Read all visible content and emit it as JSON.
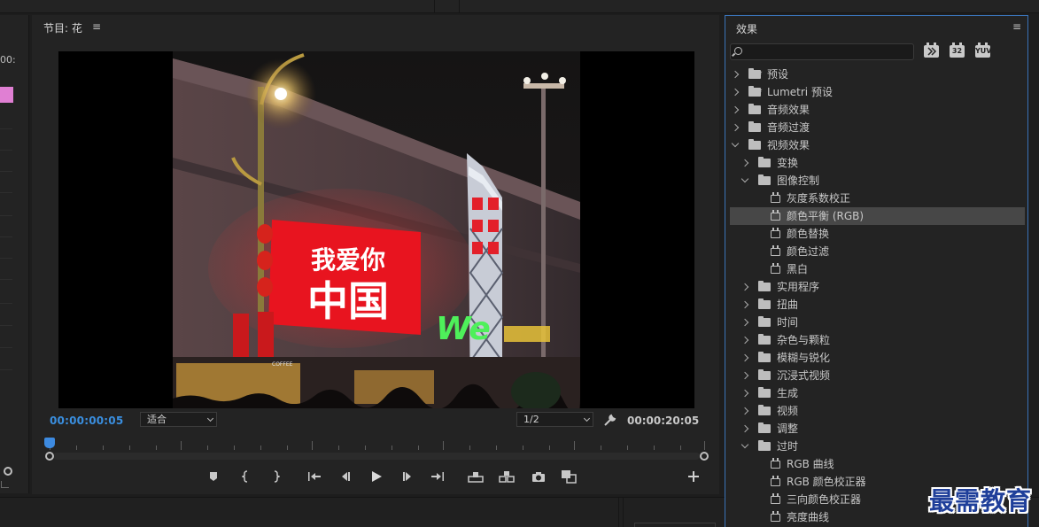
{
  "program_monitor": {
    "title": "节目: 花",
    "menu_glyph": "≡",
    "current_timecode": "00:00:00:05",
    "fit_select": "适合",
    "resolution_select": "1/2",
    "duration_timecode": "00:00:20:05"
  },
  "left_panel": {
    "timecode_fragment": "00:"
  },
  "video_frame": {
    "billboard_line1": "我爱你",
    "billboard_line2": "中国",
    "store_sign": "We",
    "coffee_sign": "COFFEE"
  },
  "transport_icons": [
    "marker-icon",
    "mark-in-icon",
    "mark-out-icon",
    "go-to-in-icon",
    "step-back-icon",
    "play-icon",
    "step-forward-icon",
    "go-to-out-icon",
    "lift-icon",
    "extract-icon",
    "export-frame-icon",
    "compare-icon",
    "add-button-icon"
  ],
  "effects_panel": {
    "title": "效果",
    "menu_glyph": "≡",
    "search_placeholder": "",
    "badges": [
      "32",
      "YUV"
    ],
    "tree": [
      {
        "label": "预设",
        "type": "folder-star",
        "level": 0,
        "expanded": false
      },
      {
        "label": "Lumetri 预设",
        "type": "folder-star",
        "level": 0,
        "expanded": false
      },
      {
        "label": "音频效果",
        "type": "folder",
        "level": 0,
        "expanded": false
      },
      {
        "label": "音频过渡",
        "type": "folder",
        "level": 0,
        "expanded": false
      },
      {
        "label": "视频效果",
        "type": "folder",
        "level": 0,
        "expanded": true
      },
      {
        "label": "变换",
        "type": "folder",
        "level": 1,
        "expanded": false
      },
      {
        "label": "图像控制",
        "type": "folder",
        "level": 1,
        "expanded": true
      },
      {
        "label": "灰度系数校正",
        "type": "effect",
        "level": 2
      },
      {
        "label": "颜色平衡 (RGB)",
        "type": "effect",
        "level": 2,
        "selected": true
      },
      {
        "label": "颜色替换",
        "type": "effect",
        "level": 2
      },
      {
        "label": "颜色过滤",
        "type": "effect",
        "level": 2
      },
      {
        "label": "黑白",
        "type": "effect",
        "level": 2
      },
      {
        "label": "实用程序",
        "type": "folder",
        "level": 1,
        "expanded": false
      },
      {
        "label": "扭曲",
        "type": "folder",
        "level": 1,
        "expanded": false
      },
      {
        "label": "时间",
        "type": "folder",
        "level": 1,
        "expanded": false
      },
      {
        "label": "杂色与颗粒",
        "type": "folder",
        "level": 1,
        "expanded": false
      },
      {
        "label": "模糊与锐化",
        "type": "folder",
        "level": 1,
        "expanded": false
      },
      {
        "label": "沉浸式视频",
        "type": "folder",
        "level": 1,
        "expanded": false
      },
      {
        "label": "生成",
        "type": "folder",
        "level": 1,
        "expanded": false
      },
      {
        "label": "视频",
        "type": "folder",
        "level": 1,
        "expanded": false
      },
      {
        "label": "调整",
        "type": "folder",
        "level": 1,
        "expanded": false
      },
      {
        "label": "过时",
        "type": "folder",
        "level": 1,
        "expanded": true
      },
      {
        "label": "RGB 曲线",
        "type": "effect",
        "level": 2
      },
      {
        "label": "RGB 颜色校正器",
        "type": "effect",
        "level": 2
      },
      {
        "label": "三向颜色校正器",
        "type": "effect",
        "level": 2
      },
      {
        "label": "亮度曲线",
        "type": "effect",
        "level": 2
      }
    ]
  },
  "watermark": "最需教育",
  "colors": {
    "accent_blue": "#3a8fe0",
    "panel_bg": "#232323",
    "selection": "#474747",
    "pink_clip": "#e07fd3",
    "panel_focus_border": "#3a73b8"
  }
}
